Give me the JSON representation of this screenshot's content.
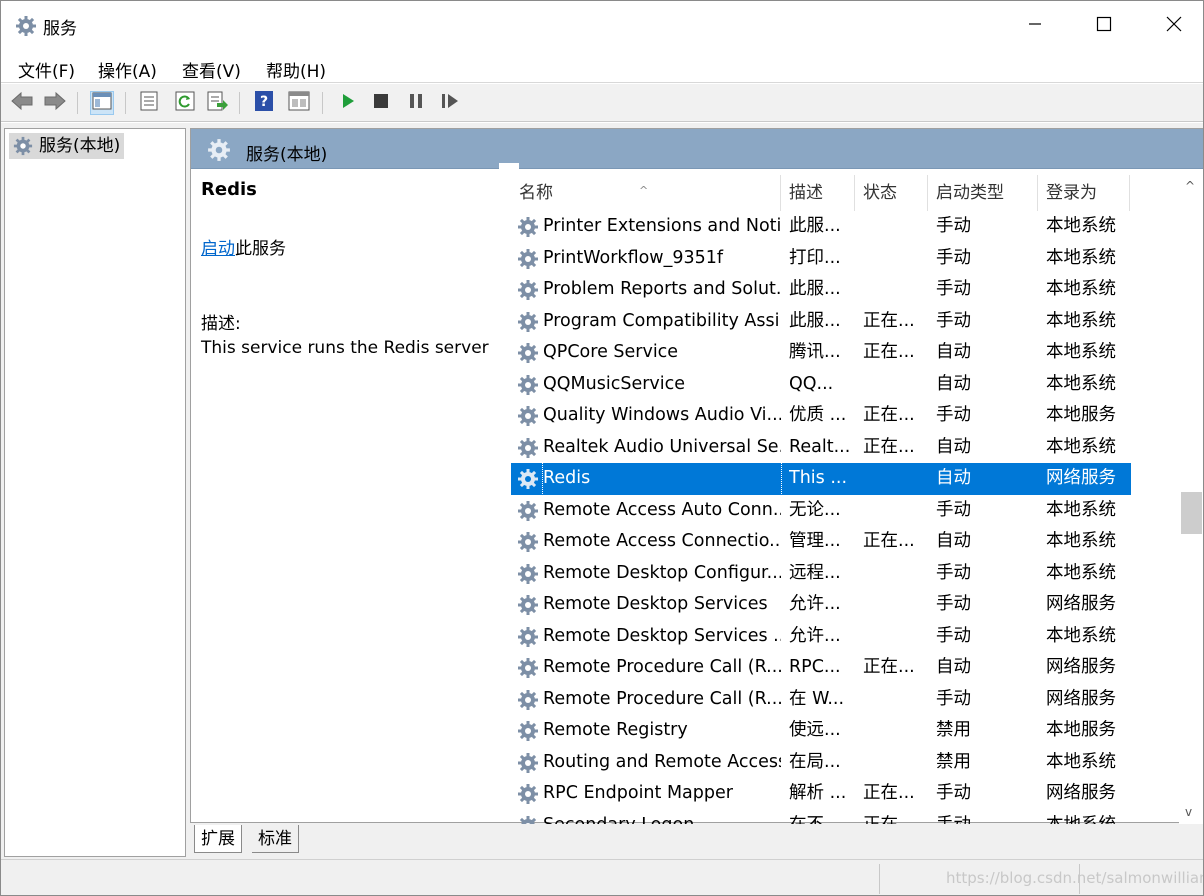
{
  "window": {
    "title": "服务"
  },
  "menu": [
    "文件(F)",
    "操作(A)",
    "查看(V)",
    "帮助(H)"
  ],
  "tree": {
    "root": "服务(本地)"
  },
  "panel": {
    "title": "服务(本地)"
  },
  "details": {
    "service_name": "Redis",
    "start_link": "启动",
    "start_suffix": "此服务",
    "desc_label": "描述:",
    "desc_text": "This service runs the Redis server"
  },
  "columns": [
    "名称",
    "描述",
    "状态",
    "启动类型",
    "登录为"
  ],
  "services": [
    {
      "name": "Printer Extensions and Noti...",
      "desc": "此服...",
      "status": "",
      "startup": "手动",
      "logon": "本地系统"
    },
    {
      "name": "PrintWorkflow_9351f",
      "desc": "打印...",
      "status": "",
      "startup": "手动",
      "logon": "本地系统"
    },
    {
      "name": "Problem Reports and Solut...",
      "desc": "此服...",
      "status": "",
      "startup": "手动",
      "logon": "本地系统"
    },
    {
      "name": "Program Compatibility Assi...",
      "desc": "此服...",
      "status": "正在...",
      "startup": "手动",
      "logon": "本地系统"
    },
    {
      "name": "QPCore Service",
      "desc": "腾讯...",
      "status": "正在...",
      "startup": "自动",
      "logon": "本地系统"
    },
    {
      "name": "QQMusicService",
      "desc": "QQ...",
      "status": "",
      "startup": "自动",
      "logon": "本地系统"
    },
    {
      "name": "Quality Windows Audio Vi...",
      "desc": "优质 ...",
      "status": "正在...",
      "startup": "手动",
      "logon": "本地服务"
    },
    {
      "name": "Realtek Audio Universal Se...",
      "desc": "Realt...",
      "status": "正在...",
      "startup": "自动",
      "logon": "本地系统"
    },
    {
      "name": "Redis",
      "desc": "This ...",
      "status": "",
      "startup": "自动",
      "logon": "网络服务",
      "selected": true
    },
    {
      "name": "Remote Access Auto Conn...",
      "desc": "无论...",
      "status": "",
      "startup": "手动",
      "logon": "本地系统"
    },
    {
      "name": "Remote Access Connectio...",
      "desc": "管理...",
      "status": "正在...",
      "startup": "自动",
      "logon": "本地系统"
    },
    {
      "name": "Remote Desktop Configur...",
      "desc": "远程...",
      "status": "",
      "startup": "手动",
      "logon": "本地系统"
    },
    {
      "name": "Remote Desktop Services",
      "desc": "允许...",
      "status": "",
      "startup": "手动",
      "logon": "网络服务"
    },
    {
      "name": "Remote Desktop Services ...",
      "desc": "允许...",
      "status": "",
      "startup": "手动",
      "logon": "本地系统"
    },
    {
      "name": "Remote Procedure Call (R...",
      "desc": "RPC...",
      "status": "正在...",
      "startup": "自动",
      "logon": "网络服务"
    },
    {
      "name": "Remote Procedure Call (R...",
      "desc": "在 W...",
      "status": "",
      "startup": "手动",
      "logon": "网络服务"
    },
    {
      "name": "Remote Registry",
      "desc": "使远...",
      "status": "",
      "startup": "禁用",
      "logon": "本地服务"
    },
    {
      "name": "Routing and Remote Access",
      "desc": "在局...",
      "status": "",
      "startup": "禁用",
      "logon": "本地系统"
    },
    {
      "name": "RPC Endpoint Mapper",
      "desc": "解析 ...",
      "status": "正在...",
      "startup": "手动",
      "logon": "网络服务"
    },
    {
      "name": "Secondary Logon",
      "desc": "在不...",
      "status": "正在...",
      "startup": "手动",
      "logon": "本地系统"
    }
  ],
  "tabs": [
    "扩展",
    "标准"
  ],
  "watermark": "https://blog.csdn.net/salmonwilliam",
  "colors": {
    "selection": "#0078d7",
    "header": "#8ba7c4",
    "link": "#0066cc"
  },
  "icons": [
    "gear-icon",
    "back-arrow-icon",
    "forward-arrow-icon",
    "show-tree-icon",
    "properties-icon",
    "refresh-icon",
    "export-icon",
    "help-icon",
    "console-icon",
    "start-icon",
    "stop-icon",
    "pause-icon",
    "resume-icon",
    "minimize-icon",
    "maximize-icon",
    "close-icon"
  ]
}
